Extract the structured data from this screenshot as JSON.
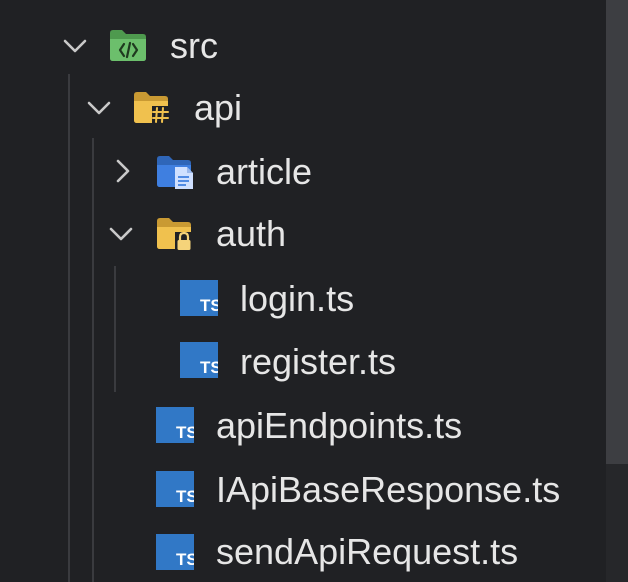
{
  "tree": {
    "src": {
      "label": "src",
      "expanded": true,
      "icon": "folder-code-icon"
    },
    "api": {
      "label": "api",
      "expanded": true,
      "icon": "folder-hash-icon"
    },
    "article": {
      "label": "article",
      "expanded": false,
      "icon": "folder-doc-icon"
    },
    "auth": {
      "label": "auth",
      "expanded": true,
      "icon": "folder-lock-icon"
    },
    "files_auth": [
      {
        "label": "login.ts",
        "icon": "typescript-file-icon"
      },
      {
        "label": "register.ts",
        "icon": "typescript-file-icon"
      }
    ],
    "files_api": [
      {
        "label": "apiEndpoints.ts",
        "icon": "typescript-file-icon"
      },
      {
        "label": "IApiBaseResponse.ts",
        "icon": "typescript-file-icon"
      },
      {
        "label": "sendApiRequest.ts",
        "icon": "typescript-file-icon"
      }
    ]
  },
  "colors": {
    "background": "#202124",
    "text": "#e6e6e6",
    "chevron": "#c9c9c9",
    "folder_green": "#5aa35a",
    "folder_yellow": "#e8b84a",
    "folder_blue": "#3b7ad9",
    "ts_blue": "#3178c6"
  }
}
